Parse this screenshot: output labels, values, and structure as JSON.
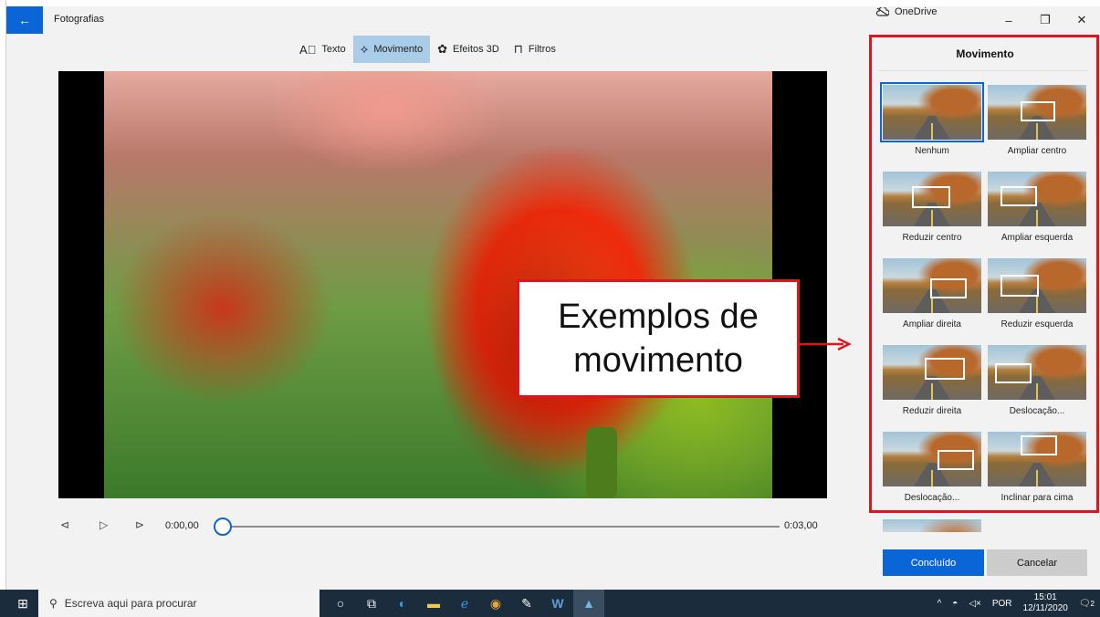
{
  "window": {
    "back_icon": "←",
    "app_title": "Fotografias",
    "onedrive_label": "OneDrive",
    "onedrive_icon": "cloud-off-icon",
    "minimize": "–",
    "restore": "❐",
    "close": "✕"
  },
  "toolbar": {
    "items": [
      {
        "label": "Texto",
        "icon": "text-box-icon",
        "glyph": "A⃞"
      },
      {
        "label": "Movimento",
        "icon": "motion-icon",
        "glyph": "⟡"
      },
      {
        "label": "Efeitos 3D",
        "icon": "effects-3d-icon",
        "glyph": "✿"
      },
      {
        "label": "Filtros",
        "icon": "filter-icon",
        "glyph": "⊓"
      }
    ],
    "active": "Movimento"
  },
  "playback": {
    "prev_glyph": "⊲",
    "play_glyph": "▷",
    "next_glyph": "⊳",
    "current_time": "0:00,00",
    "end_time": "0:03,00",
    "progress": 0
  },
  "callout": {
    "line1": "Exemplos de",
    "line2": "movimento"
  },
  "panel": {
    "title": "Movimento",
    "selected": "Nenhum",
    "options": [
      {
        "label": "Nenhum"
      },
      {
        "label": "Ampliar centro"
      },
      {
        "label": "Reduzir centro"
      },
      {
        "label": "Ampliar esquerda"
      },
      {
        "label": "Ampliar direita"
      },
      {
        "label": "Reduzir esquerda"
      },
      {
        "label": "Reduzir direita"
      },
      {
        "label": "Deslocação..."
      },
      {
        "label": "Deslocação..."
      },
      {
        "label": "Inclinar para cima"
      }
    ],
    "done_label": "Concluído",
    "cancel_label": "Cancelar"
  },
  "taskbar": {
    "search_placeholder": "Escreva aqui para procurar",
    "search_glyph": "⚲",
    "start_glyph": "⊞",
    "apps": [
      {
        "icon": "cortana-icon",
        "glyph": "○"
      },
      {
        "icon": "task-view-icon",
        "glyph": "⧉"
      },
      {
        "icon": "edge-icon",
        "glyph": "◐"
      },
      {
        "icon": "file-explorer-icon",
        "glyph": "▬"
      },
      {
        "icon": "internet-explorer-icon",
        "glyph": "ℯ"
      },
      {
        "icon": "chrome-icon",
        "glyph": "◉"
      },
      {
        "icon": "paint-icon",
        "glyph": "✎"
      },
      {
        "icon": "word-icon",
        "glyph": "W"
      },
      {
        "icon": "photos-icon",
        "glyph": "▲"
      }
    ],
    "tray": {
      "chevron": "^",
      "language": "POR",
      "time": "15:01",
      "date": "12/11/2020",
      "notifications": "2"
    }
  },
  "colors": {
    "accent": "#0a66d6",
    "highlight": "#e0141e",
    "taskbar": "#1b2c3c"
  }
}
